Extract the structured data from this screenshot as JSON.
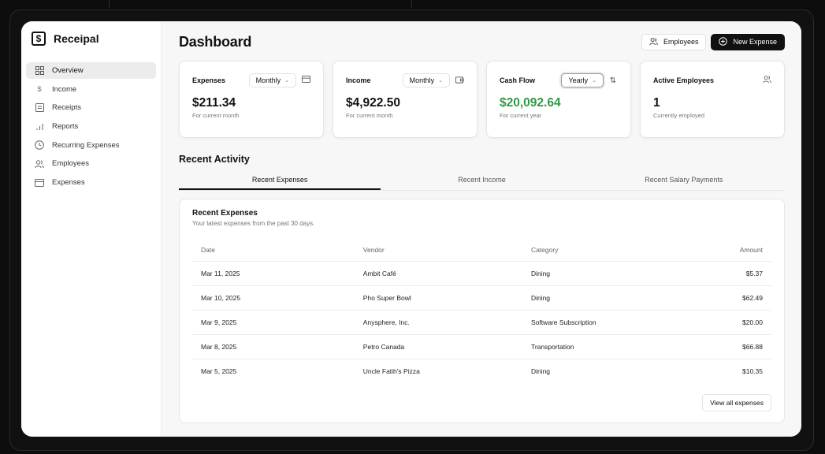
{
  "app": {
    "name": "Receipal"
  },
  "sidebar": {
    "items": [
      {
        "label": "Overview",
        "icon": "grid-icon",
        "active": true
      },
      {
        "label": "Income",
        "icon": "dollar-icon"
      },
      {
        "label": "Receipts",
        "icon": "receipt-icon"
      },
      {
        "label": "Reports",
        "icon": "bar-chart-icon"
      },
      {
        "label": "Recurring Expenses",
        "icon": "clock-icon"
      },
      {
        "label": "Employees",
        "icon": "users-icon"
      },
      {
        "label": "Expenses",
        "icon": "credit-card-icon"
      }
    ]
  },
  "header": {
    "title": "Dashboard",
    "employees_label": "Employees",
    "new_expense_label": "New Expense"
  },
  "cards": {
    "expenses": {
      "title": "Expenses",
      "period": "Monthly",
      "value": "$211.34",
      "sub": "For current month"
    },
    "income": {
      "title": "Income",
      "period": "Monthly",
      "value": "$4,922.50",
      "sub": "For current month"
    },
    "cashflow": {
      "title": "Cash Flow",
      "period": "Yearly",
      "value": "$20,092.64",
      "sub": "For current year",
      "value_color": "#2e9a45"
    },
    "employees": {
      "title": "Active Employees",
      "value": "1",
      "sub": "Currently employed"
    }
  },
  "activity": {
    "title": "Recent Activity",
    "tabs": [
      "Recent Expenses",
      "Recent Income",
      "Recent Salary Payments"
    ],
    "panel": {
      "title": "Recent Expenses",
      "subtitle": "Your latest expenses from the past 30 days.",
      "columns": [
        "Date",
        "Vendor",
        "Category",
        "Amount"
      ],
      "rows": [
        [
          "Mar 11, 2025",
          "Ambit Café",
          "Dining",
          "$5.37"
        ],
        [
          "Mar 10, 2025",
          "Pho Super Bowl",
          "Dining",
          "$62.49"
        ],
        [
          "Mar 9, 2025",
          "Anysphere, Inc.",
          "Software Subscription",
          "$20.00"
        ],
        [
          "Mar 8, 2025",
          "Petro Canada",
          "Transportation",
          "$66.88"
        ],
        [
          "Mar 5, 2025",
          "Uncle Fatih's Pizza",
          "Dining",
          "$10.35"
        ]
      ],
      "view_all_label": "View all expenses"
    }
  }
}
